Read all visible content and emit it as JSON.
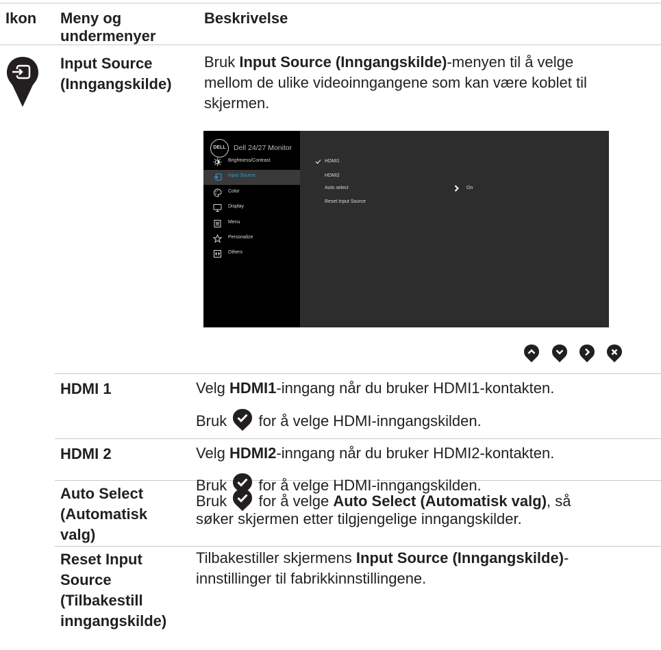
{
  "header": {
    "col_icon": "Ikon",
    "col_menu_line1": "Meny og",
    "col_menu_line2": "undermenyer",
    "col_desc": "Beskrivelse"
  },
  "input_source": {
    "label_line1": "Input Source",
    "label_line2": "(Inngangskilde)",
    "desc_line1_pre": "Bruk ",
    "desc_line1_bold": "Input Source (Inngangskilde)",
    "desc_line1_post": "-menyen til å velge",
    "desc_line2": "mellom de ulike videoinngangene som kan være koblet til",
    "desc_line3": "skjermen.",
    "icon": "input-source-icon"
  },
  "osd": {
    "logo": "DELL",
    "title": "Dell 24/27 Monitor",
    "menu": [
      {
        "label": "Brightness/Contrast",
        "icon": "brightness-icon"
      },
      {
        "label": "Input Source",
        "icon": "input-source-icon",
        "active": true
      },
      {
        "label": "Color",
        "icon": "palette-icon"
      },
      {
        "label": "Display",
        "icon": "monitor-icon"
      },
      {
        "label": "Menu",
        "icon": "menu-icon"
      },
      {
        "label": "Personalize",
        "icon": "star-icon"
      },
      {
        "label": "Others",
        "icon": "others-icon"
      }
    ],
    "submenu": {
      "hdmi1": "HDMI1",
      "hdmi2": "HDMI2",
      "auto_select": "Auto select",
      "auto_select_value": "On",
      "reset": "Reset Input Source"
    },
    "accent_color": "#2e9ad6"
  },
  "nav_buttons": [
    "up-icon",
    "down-icon",
    "right-icon",
    "close-icon"
  ],
  "rows": {
    "hdmi1": {
      "label": "HDMI 1",
      "line1_pre": "Velg ",
      "line1_bold": "HDMI1",
      "line1_post": "-inngang når du bruker HDMI1-kontakten.",
      "line2_pre": "Bruk ",
      "line2_post": " for å velge HDMI-inngangskilden."
    },
    "hdmi2": {
      "label": "HDMI 2",
      "line1_pre": "Velg ",
      "line1_bold": "HDMI2",
      "line1_post": "-inngang når du bruker HDMI2-kontakten.",
      "line2_pre": "Bruk ",
      "line2_post": " for å velge HDMI-inngangskilden."
    },
    "auto_select": {
      "label_line1": "Auto Select",
      "label_line2": "(Automatisk",
      "label_line3": "valg)",
      "line1_pre": "Bruk ",
      "line1_mid": " for å velge ",
      "line1_bold": "Auto Select (Automatisk valg)",
      "line1_post": ", så",
      "line2": "søker skjermen etter tilgjengelige inngangskilder."
    },
    "reset": {
      "label_line1": "Reset Input",
      "label_line2": "Source",
      "label_line3": "(Tilbakestill",
      "label_line4": "inngangskilde)",
      "line1_pre": "Tilbakestiller skjermens ",
      "line1_bold": "Input Source (Inngangskilde)",
      "line1_post": "-",
      "line2": "innstillinger til fabrikkinnstillingene."
    }
  }
}
